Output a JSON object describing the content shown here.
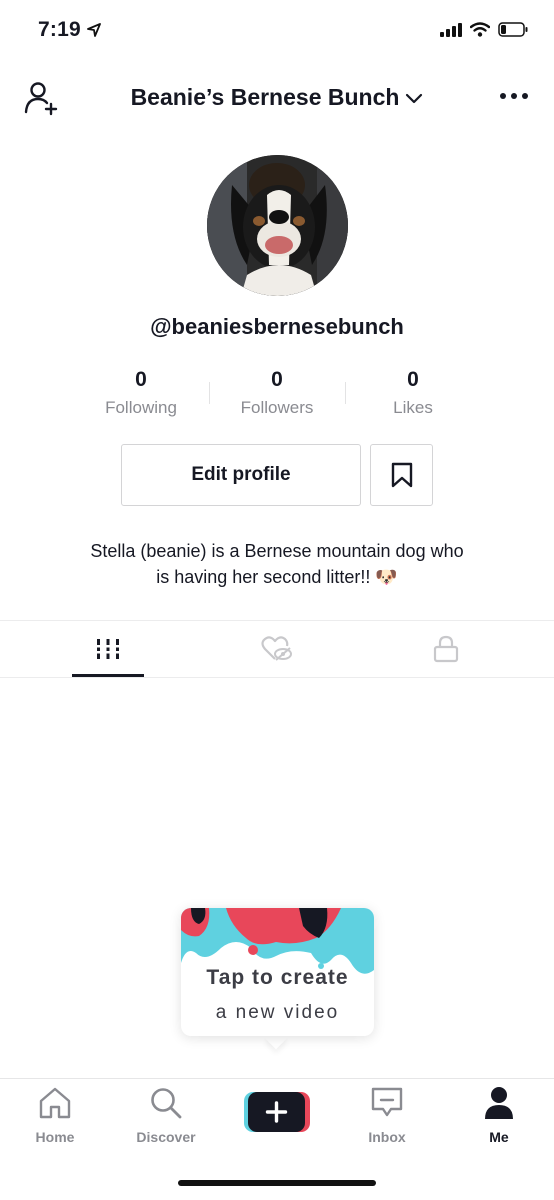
{
  "status_bar": {
    "time": "7:19"
  },
  "header": {
    "title": "Beanie’s Bernese Bunch"
  },
  "profile": {
    "username": "@beaniesbernesebunch",
    "stats": [
      {
        "value": "0",
        "label": "Following"
      },
      {
        "value": "0",
        "label": "Followers"
      },
      {
        "value": "0",
        "label": "Likes"
      }
    ],
    "edit_profile_label": "Edit profile",
    "bio_line1": "Stella (beanie) is a Bernese mountain dog who",
    "bio_line2": "is having her second litter!! 🐶"
  },
  "tabs": [
    "videos-grid-icon",
    "liked-hidden-icon",
    "lock-icon"
  ],
  "create_prompt": {
    "line1": "Tap to create",
    "line2": "a new video"
  },
  "bottom_nav": {
    "home": "Home",
    "discover": "Discover",
    "inbox": "Inbox",
    "me": "Me"
  },
  "colors": {
    "accent_cyan": "#5fd1e0",
    "accent_red": "#e8475a",
    "text": "#161823",
    "muted": "#8a8b91"
  }
}
